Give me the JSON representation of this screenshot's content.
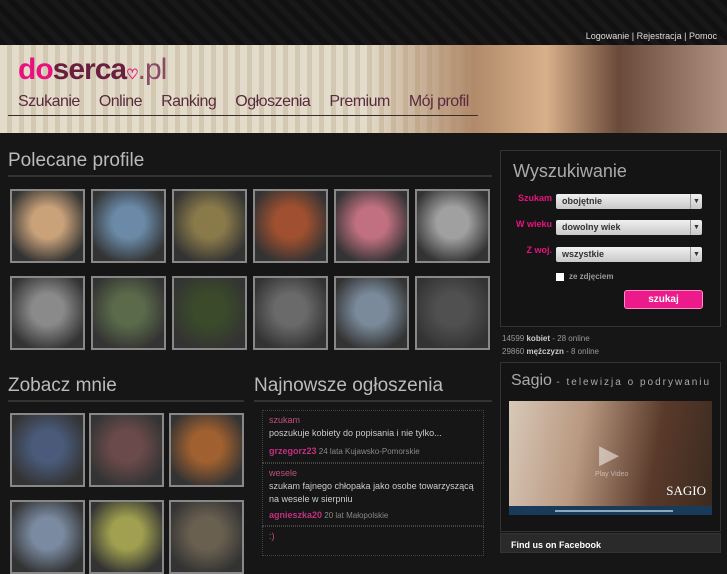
{
  "top_links": [
    "Logowanie",
    "Rejestracja",
    "Pomoc"
  ],
  "logo": {
    "do": "do",
    "serca": "serca",
    "pl": ".pl"
  },
  "nav": [
    "Szukanie",
    "Online",
    "Ranking",
    "Ogłoszenia",
    "Premium",
    "Mój profil"
  ],
  "featured": {
    "title": "Polecane profile"
  },
  "see_me": {
    "title": "Zobacz mnie"
  },
  "ads": {
    "title": "Najnowsze ogłoszenia",
    "items": [
      {
        "title": "szukam",
        "text": "poszukuje kobiety do popisania i nie tylko...",
        "user": "grzegorz23",
        "info": "24 lata Kujawsko-Pomorskie"
      },
      {
        "title": "wesele",
        "text": "szukam fajnego chłopaka jako osobe towarzyszącą na wesele w sierpniu",
        "user": "agnieszka20",
        "info": "20 lat Małopolskie"
      },
      {
        "title": ":)",
        "text": "",
        "user": "",
        "info": ""
      }
    ]
  },
  "search": {
    "title": "Wyszukiwanie",
    "fields": [
      {
        "label": "Szukam",
        "value": "obojętnie"
      },
      {
        "label": "W wieku",
        "value": "dowolny wiek"
      },
      {
        "label": "Z woj.",
        "value": "wszystkie"
      }
    ],
    "checkbox": "ze zdjęciem",
    "button": "szukaj"
  },
  "stats": [
    {
      "count": "14599",
      "group": "kobiet",
      "online": "- 28 online"
    },
    {
      "count": "29860",
      "group": "mężczyzn",
      "online": "- 8 online"
    }
  ],
  "sagio": {
    "title": "Sagio",
    "subtitle": "- telewizja o podrywaniu",
    "brand": "SAGIO",
    "play": "Play Video"
  },
  "facebook": {
    "title": "Find us on Facebook"
  },
  "colors": {
    "accent": "#e8127f",
    "bg": "#161616"
  }
}
